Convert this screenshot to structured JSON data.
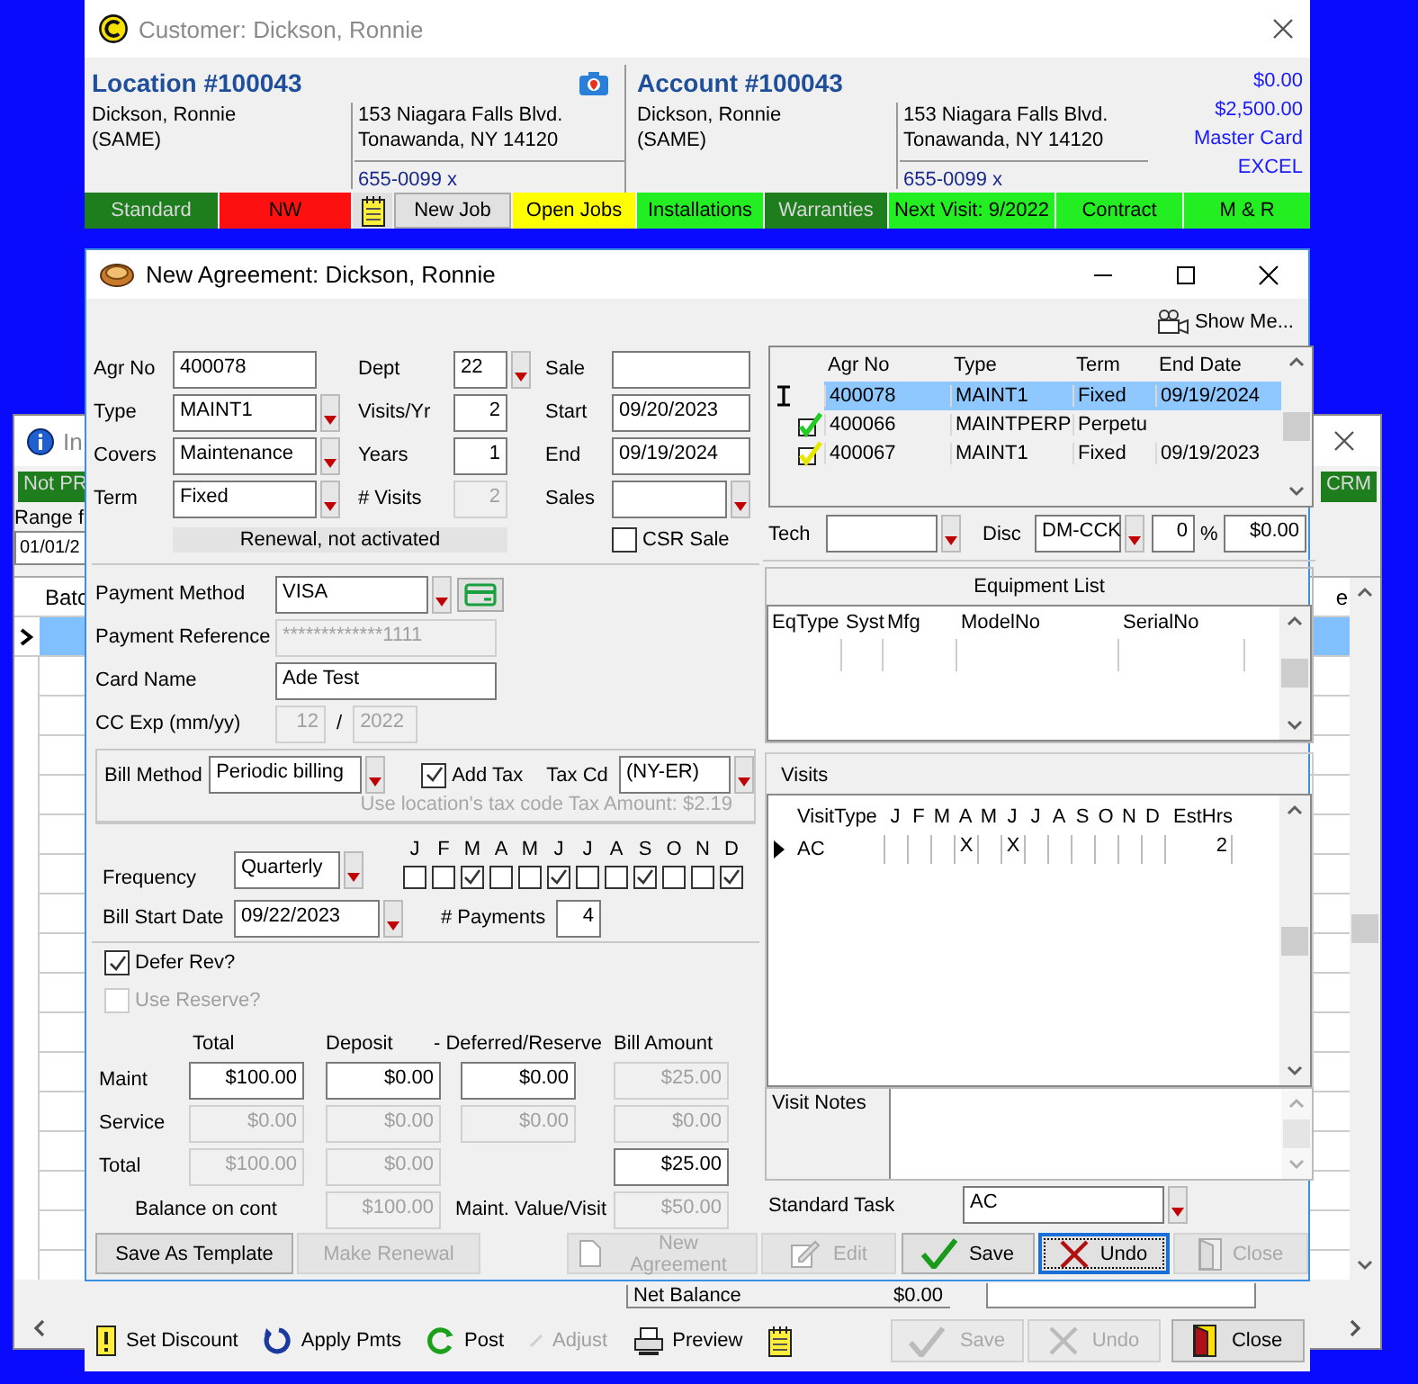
{
  "customer_window": {
    "title": "Customer: Dickson,  Ronnie",
    "location": {
      "heading": "Location #100043",
      "name": "Dickson,  Ronnie",
      "note": "(SAME)",
      "address_line_1": "153 Niagara Falls Blvd.",
      "address_line_2": "Tonawanda, NY  14120",
      "phone": "655-0099 x"
    },
    "account": {
      "heading": "Account #100043",
      "name": "Dickson,  Ronnie",
      "note": "(SAME)",
      "address_line_1": "153 Niagara Falls Blvd.",
      "address_line_2": "Tonawanda, NY  14120",
      "phone": "655-0099 x"
    },
    "amounts": [
      "$0.00",
      "$2,500.00",
      "Master Card",
      "EXCEL"
    ],
    "status_bar": [
      {
        "kind": "tag",
        "label": "Standard",
        "color": "#1e7e1e"
      },
      {
        "kind": "tag",
        "label": "NW",
        "color": "#ff1010"
      },
      {
        "kind": "notepad"
      },
      {
        "kind": "button",
        "label": "New Job"
      },
      {
        "kind": "tag",
        "label": "Open Jobs",
        "color": "#ffff00"
      },
      {
        "kind": "tag",
        "label": "Installations",
        "color": "#22ee22"
      },
      {
        "kind": "tag",
        "label": "Warranties",
        "color": "#1e7e1e"
      },
      {
        "kind": "tag",
        "label": "Next Visit: 9/2022",
        "color": "#22ee22"
      },
      {
        "kind": "tag",
        "label": "Contract",
        "color": "#22ee22"
      },
      {
        "kind": "tag",
        "label": "M & R",
        "color": "#22ee22"
      }
    ],
    "toolbar": [
      {
        "kind": "discount",
        "label": "Set Discount",
        "disabled": false
      },
      {
        "kind": "apply",
        "label": "Apply Pmts",
        "disabled": false
      },
      {
        "kind": "post",
        "label": "Post",
        "disabled": false
      },
      {
        "kind": "adjust",
        "label": "Adjust",
        "disabled": true
      },
      {
        "kind": "preview",
        "label": "Preview",
        "disabled": false
      },
      {
        "kind": "notepad",
        "disabled": false
      }
    ],
    "buttons": [
      {
        "kind": "save",
        "label": "Save",
        "disabled": true
      },
      {
        "kind": "undo",
        "label": "Undo",
        "disabled": true
      },
      {
        "kind": "close",
        "label": "Close",
        "disabled": false
      }
    ]
  },
  "background_window": {
    "title": "In",
    "tags": [
      {
        "label": "Not PR",
        "color": "#1e7e1e"
      },
      {
        "label": "CRM",
        "color": "#1e7e1e"
      }
    ],
    "range_label": "Range f",
    "range_value": "01/01/2",
    "column_1": "Batc",
    "column_2": "e",
    "net_balance_label": "Net Balance",
    "net_balance": "$0.00"
  },
  "agreement_dialog": {
    "title": "New Agreement: Dickson, Ronnie",
    "show_me": "Show Me...",
    "fields_left": [
      {
        "label": "Agr No",
        "value": "400078",
        "kind": "text",
        "disabled": false
      },
      {
        "label": "Type",
        "value": "MAINT1",
        "kind": "combo",
        "disabled": false
      },
      {
        "label": "Covers",
        "value": "Maintenance",
        "kind": "combo",
        "disabled": false
      },
      {
        "label": "Term",
        "value": "Fixed",
        "kind": "combo",
        "disabled": false
      }
    ],
    "fields_mid": [
      {
        "label": "Dept",
        "value": "22",
        "kind": "combo",
        "disabled": false
      },
      {
        "label": "Visits/Yr",
        "value": "2",
        "kind": "number",
        "disabled": false
      },
      {
        "label": "Years",
        "value": "1",
        "kind": "number",
        "disabled": false
      },
      {
        "label": "# Visits",
        "value": "2",
        "kind": "number",
        "disabled": true
      }
    ],
    "fields_right": [
      {
        "label": "Sale",
        "kind": "text",
        "disabled": false
      },
      {
        "label": "Start",
        "value": "09/20/2023",
        "kind": "text",
        "disabled": false
      },
      {
        "label": "End",
        "value": "09/19/2024",
        "kind": "text",
        "disabled": false
      },
      {
        "label": "Sales",
        "kind": "combo",
        "disabled": false
      }
    ],
    "renewal_status": "Renewal, not activated",
    "csr_sale": {
      "label": "CSR Sale",
      "checked": false
    },
    "agreements_table": {
      "columns": [
        "Agr No",
        "Type",
        "Term",
        "End Date"
      ],
      "rows": [
        {
          "selected": true,
          "cells": [
            "400078",
            "MAINT1",
            "Fixed",
            "09/19/2024"
          ]
        },
        {
          "selected": false,
          "color": "#22cc22",
          "cells": [
            "400066",
            "MAINTPERP",
            "Perpetu"
          ]
        },
        {
          "selected": false,
          "color": "#e6e600",
          "cells": [
            "400067",
            "MAINT1",
            "Fixed",
            "09/19/2023"
          ]
        }
      ]
    },
    "tech_label": "Tech",
    "disc_label": "Disc",
    "disc_code": "DM-CCK",
    "disc_percent": "0",
    "percent_sign": "%",
    "disc_amount": "$0.00",
    "payment": {
      "method_label": "Payment Method",
      "method": "VISA",
      "reference_label": "Payment Reference",
      "reference": "*************1111",
      "card_name_label": "Card Name",
      "card_name": "Ade Test",
      "exp_label": "CC Exp (mm/yy)",
      "exp_month": "12",
      "exp_separator": "/",
      "exp_year": "2022"
    },
    "billing": {
      "method_label": "Bill Method",
      "method": "Periodic billing",
      "add_tax": {
        "label": "Add Tax",
        "checked": true
      },
      "tax_code_label": "Tax Cd",
      "tax_code": "(NY-ER)",
      "tax_note": "Use location's tax code  Tax Amount: $2.19"
    },
    "schedule": {
      "frequency_label": "Frequency",
      "frequency": "Quarterly",
      "start_label": "Bill Start Date",
      "start": "09/22/2023",
      "payments_label": "# Payments",
      "payments": "4",
      "months": [
        {
          "label": "J",
          "checked": false
        },
        {
          "label": "F",
          "checked": false
        },
        {
          "label": "M",
          "checked": true
        },
        {
          "label": "A",
          "checked": false
        },
        {
          "label": "M",
          "checked": false
        },
        {
          "label": "J",
          "checked": true
        },
        {
          "label": "J",
          "checked": false
        },
        {
          "label": "A",
          "checked": false
        },
        {
          "label": "S",
          "checked": true
        },
        {
          "label": "O",
          "checked": false
        },
        {
          "label": "N",
          "checked": false
        },
        {
          "label": "D",
          "checked": true
        }
      ]
    },
    "defer_rev": {
      "label": "Defer Rev?",
      "checked": true,
      "disabled": false
    },
    "use_reserve": {
      "label": "Use Reserve?",
      "checked": false,
      "disabled": true
    },
    "amounts": {
      "total_header": "Total",
      "deposit_header": "Deposit",
      "deferred_header": "- Deferred/Reserve",
      "bill_header": "Bill Amount",
      "rows": [
        {
          "label": "Maint",
          "cells": [
            {
              "kind": "field",
              "value": "$100.00",
              "disabled": false
            },
            {
              "kind": "field",
              "value": "$0.00",
              "disabled": false
            },
            {
              "kind": "field",
              "value": "$0.00",
              "disabled": false
            },
            {
              "kind": "field",
              "value": "$25.00",
              "disabled": true
            }
          ]
        },
        {
          "label": "Service",
          "cells": [
            {
              "kind": "field",
              "value": "$0.00",
              "disabled": true
            },
            {
              "kind": "field",
              "value": "$0.00",
              "disabled": true
            },
            {
              "kind": "field",
              "value": "$0.00",
              "disabled": true
            },
            {
              "kind": "field",
              "value": "$0.00",
              "disabled": true
            }
          ]
        },
        {
          "label": "Total",
          "cells": [
            {
              "kind": "field",
              "value": "$100.00",
              "disabled": true
            },
            {
              "kind": "field",
              "value": "$0.00",
              "disabled": true
            },
            {
              "kind": "blank"
            },
            {
              "kind": "field",
              "value": "$25.00",
              "disabled": false
            }
          ]
        }
      ],
      "balance_label": "Balance on cont",
      "balance": "$100.00",
      "per_visit_label": "Maint. Value/Visit",
      "per_visit": "$50.00"
    },
    "equipment": {
      "title": "Equipment List",
      "columns": [
        "EqType",
        "Syst",
        "Mfg",
        "ModelNo",
        "SerialNo"
      ]
    },
    "visits": {
      "title": "Visits",
      "columns": [
        "VisitType",
        "J",
        "F",
        "M",
        "A",
        "M",
        "J",
        "J",
        "A",
        "S",
        "O",
        "N",
        "D",
        "EstHrs"
      ],
      "rows": [
        {
          "type": "AC",
          "est_hrs": "2",
          "months": [
            {
              "scheduled": false
            },
            {
              "scheduled": false
            },
            {
              "scheduled": false
            },
            {
              "scheduled": true,
              "mark": "X"
            },
            {
              "scheduled": false
            },
            {
              "scheduled": true,
              "mark": "X"
            },
            {
              "scheduled": false
            },
            {
              "scheduled": false
            },
            {
              "scheduled": false
            },
            {
              "scheduled": false
            },
            {
              "scheduled": false
            },
            {
              "scheduled": false
            }
          ]
        }
      ]
    },
    "visit_notes_label": "Visit Notes",
    "standard_task": {
      "label": "Standard Task",
      "value": "AC"
    },
    "footer_buttons": [
      {
        "kind": "plain",
        "label": "Save As Template",
        "disabled": false,
        "focused": false
      },
      {
        "kind": "plain",
        "label": "Make Renewal",
        "disabled": true,
        "focused": false
      },
      {
        "kind": "new",
        "label": "New Agreement",
        "disabled": true,
        "focused": false
      },
      {
        "kind": "edit",
        "label": "Edit",
        "disabled": true,
        "focused": false
      },
      {
        "kind": "save",
        "label": "Save",
        "disabled": false,
        "focused": false
      },
      {
        "kind": "undo",
        "label": "Undo",
        "disabled": false,
        "focused": true
      },
      {
        "kind": "close",
        "label": "Close",
        "disabled": true,
        "focused": false
      }
    ]
  }
}
